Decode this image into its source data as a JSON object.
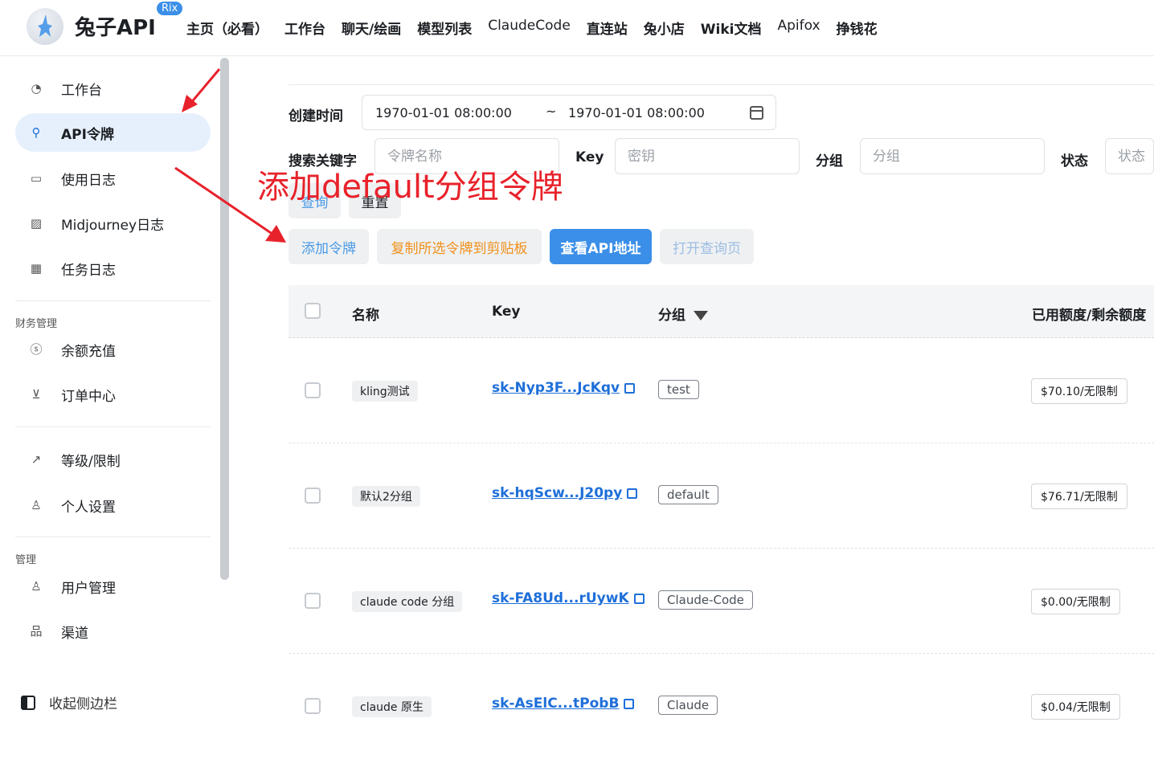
{
  "header": {
    "brand": "兔子API",
    "badge": "Rix",
    "nav": [
      "主页（必看）",
      "工作台",
      "聊天/绘画",
      "模型列表",
      "ClaudeCode",
      "直连站",
      "兔小店",
      "Wiki文档",
      "Apifox",
      "挣钱花"
    ]
  },
  "sidebar": {
    "items": [
      {
        "label": "工作台",
        "icon": "dashboard-icon"
      },
      {
        "label": "API令牌",
        "icon": "key-icon"
      },
      {
        "label": "使用日志",
        "icon": "log-icon"
      },
      {
        "label": "Midjourney日志",
        "icon": "image-icon"
      },
      {
        "label": "任务日志",
        "icon": "film-icon"
      }
    ],
    "finance_group": "财务管理",
    "finance_items": [
      {
        "label": "余额充值",
        "icon": "coin-icon"
      },
      {
        "label": "订单中心",
        "icon": "order-icon"
      }
    ],
    "personal_items": [
      {
        "label": "等级/限制",
        "icon": "trend-icon"
      },
      {
        "label": "个人设置",
        "icon": "user-icon"
      }
    ],
    "admin_group": "管理",
    "admin_items": [
      {
        "label": "用户管理",
        "icon": "users-icon"
      },
      {
        "label": "渠道",
        "icon": "channel-icon"
      }
    ],
    "collapse_label": "收起侧边栏"
  },
  "filters": {
    "created_label": "创建时间",
    "date_start": "1970-01-01 08:00:00",
    "date_sep": "~",
    "date_end": "1970-01-01 08:00:00",
    "keyword_label": "搜索关键字",
    "keyword_placeholder": "令牌名称",
    "key_label": "Key",
    "key_placeholder": "密钥",
    "group_label": "分组",
    "group_placeholder": "分组",
    "status_label": "状态",
    "status_placeholder": "状态",
    "query_button": "查询",
    "reset_button": "重置"
  },
  "actions": {
    "add": "添加令牌",
    "copy": "复制所选令牌到剪贴板",
    "view_api": "查看API地址",
    "open_query": "打开查询页"
  },
  "annotation": "添加default分组令牌",
  "table": {
    "headers": {
      "name": "名称",
      "key": "Key",
      "group": "分组",
      "quota": "已用额度/剩余额度"
    },
    "rows": [
      {
        "name": "kling测试",
        "key": "sk-Nyp3F...JcKqv",
        "group": "test",
        "quota": "$70.10/无限制"
      },
      {
        "name": "默认2分组",
        "key": "sk-hqScw...J20py",
        "group": "default",
        "quota": "$76.71/无限制"
      },
      {
        "name": "claude code 分组",
        "key": "sk-FA8Ud...rUywK",
        "group": "Claude-Code",
        "quota": "$0.00/无限制"
      },
      {
        "name": "claude 原生",
        "key": "sk-AsElC...tPobB",
        "group": "Claude",
        "quota": "$0.04/无限制"
      }
    ]
  }
}
